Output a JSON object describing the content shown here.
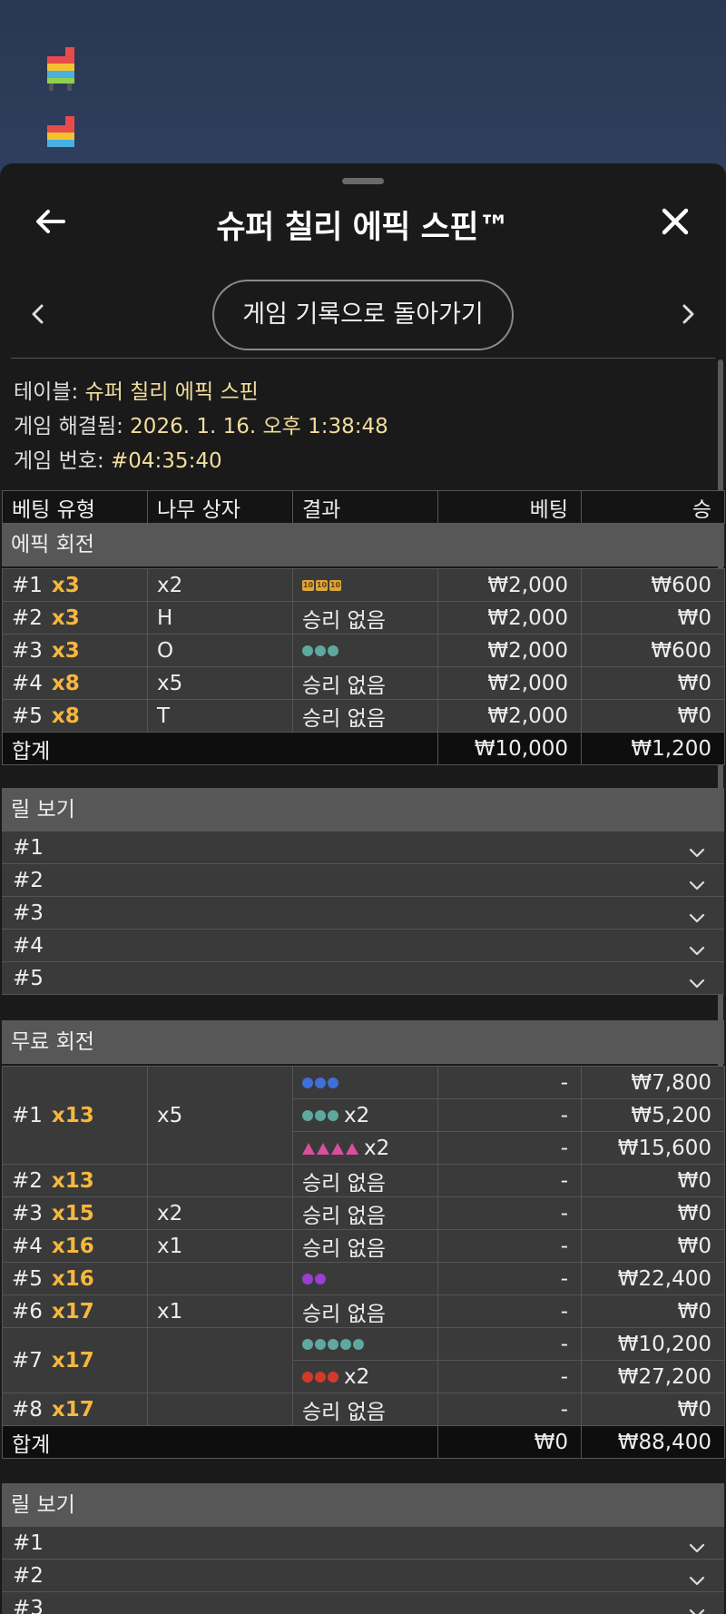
{
  "title": "슈퍼 칠리 에픽 스핀™",
  "nav": {
    "back_to_history": "게임 기록으로 돌아가기"
  },
  "info": {
    "table_label": "테이블: ",
    "table_value": "슈퍼 칠리 에픽 스핀",
    "resolved_label": "게임 해결됨: ",
    "resolved_value": "2026. 1. 16. 오후 1:38:48",
    "number_label": "게임 번호: ",
    "number_value": "#04:35:40"
  },
  "columns": [
    "베팅 유형",
    "나무 상자",
    "결과",
    "베팅",
    "승"
  ],
  "epic": {
    "section": "에픽 회전",
    "rows": [
      {
        "id": "#1",
        "mult": "x3",
        "box": "x2",
        "result": "",
        "symbol": "chip",
        "symbol_suffix": "",
        "bet": "₩2,000",
        "win": "₩600"
      },
      {
        "id": "#2",
        "mult": "x3",
        "box": "H",
        "result": "승리 없음",
        "symbol": "",
        "symbol_suffix": "",
        "bet": "₩2,000",
        "win": "₩0"
      },
      {
        "id": "#3",
        "mult": "x3",
        "box": "O",
        "result": "",
        "symbol": "teal-ball-3",
        "symbol_suffix": "",
        "bet": "₩2,000",
        "win": "₩600"
      },
      {
        "id": "#4",
        "mult": "x8",
        "box": "x5",
        "result": "승리 없음",
        "symbol": "",
        "symbol_suffix": "",
        "bet": "₩2,000",
        "win": "₩0"
      },
      {
        "id": "#5",
        "mult": "x8",
        "box": "T",
        "result": "승리 없음",
        "symbol": "",
        "symbol_suffix": "",
        "bet": "₩2,000",
        "win": "₩0"
      }
    ],
    "total_label": "합계",
    "total_bet": "₩10,000",
    "total_win": "₩1,200",
    "reels_title": "릴 보기",
    "reels": [
      "#1",
      "#2",
      "#3",
      "#4",
      "#5"
    ]
  },
  "free": {
    "section": "무료 회전",
    "sub": [
      {
        "id": "#1",
        "mult": "x13",
        "box": "x5",
        "lines": [
          {
            "symbol": "blue-ball-3",
            "suffix": "",
            "bet": "-",
            "win": "₩7,800"
          },
          {
            "symbol": "teal-ball-3",
            "suffix": "x2",
            "bet": "-",
            "win": "₩5,200"
          },
          {
            "symbol": "pink-tri-4",
            "suffix": "x2",
            "bet": "-",
            "win": "₩15,600"
          }
        ]
      },
      {
        "id": "#2",
        "mult": "x13",
        "box": "",
        "lines": [
          {
            "symbol": "",
            "text": "승리 없음",
            "suffix": "",
            "bet": "-",
            "win": "₩0"
          }
        ]
      },
      {
        "id": "#3",
        "mult": "x15",
        "box": "x2",
        "lines": [
          {
            "symbol": "",
            "text": "승리 없음",
            "suffix": "",
            "bet": "-",
            "win": "₩0"
          }
        ]
      },
      {
        "id": "#4",
        "mult": "x16",
        "box": "x1",
        "lines": [
          {
            "symbol": "",
            "text": "승리 없음",
            "suffix": "",
            "bet": "-",
            "win": "₩0"
          }
        ]
      },
      {
        "id": "#5",
        "mult": "x16",
        "box": "",
        "lines": [
          {
            "symbol": "purple-ball-2",
            "suffix": "",
            "bet": "-",
            "win": "₩22,400"
          }
        ]
      },
      {
        "id": "#6",
        "mult": "x17",
        "box": "x1",
        "lines": [
          {
            "symbol": "",
            "text": "승리 없음",
            "suffix": "",
            "bet": "-",
            "win": "₩0"
          }
        ]
      },
      {
        "id": "#7",
        "mult": "x17",
        "box": "",
        "lines": [
          {
            "symbol": "teal-ball-5",
            "suffix": "",
            "bet": "-",
            "win": "₩10,200"
          },
          {
            "symbol": "red-ball-3",
            "suffix": "x2",
            "bet": "-",
            "win": "₩27,200"
          }
        ]
      },
      {
        "id": "#8",
        "mult": "x17",
        "box": "",
        "lines": [
          {
            "symbol": "",
            "text": "승리 없음",
            "suffix": "",
            "bet": "-",
            "win": "₩0"
          }
        ]
      }
    ],
    "total_label": "합계",
    "total_bet": "₩0",
    "total_win": "₩88,400",
    "reels_title": "릴 보기",
    "reels": [
      "#1",
      "#2",
      "#3"
    ]
  },
  "colors": {
    "accent": "#f6b73c",
    "info_value": "#f2dd9c",
    "sheet_bg": "#1a1a1a",
    "row_bg": "#3a3a3a",
    "section_bg": "#575757"
  }
}
